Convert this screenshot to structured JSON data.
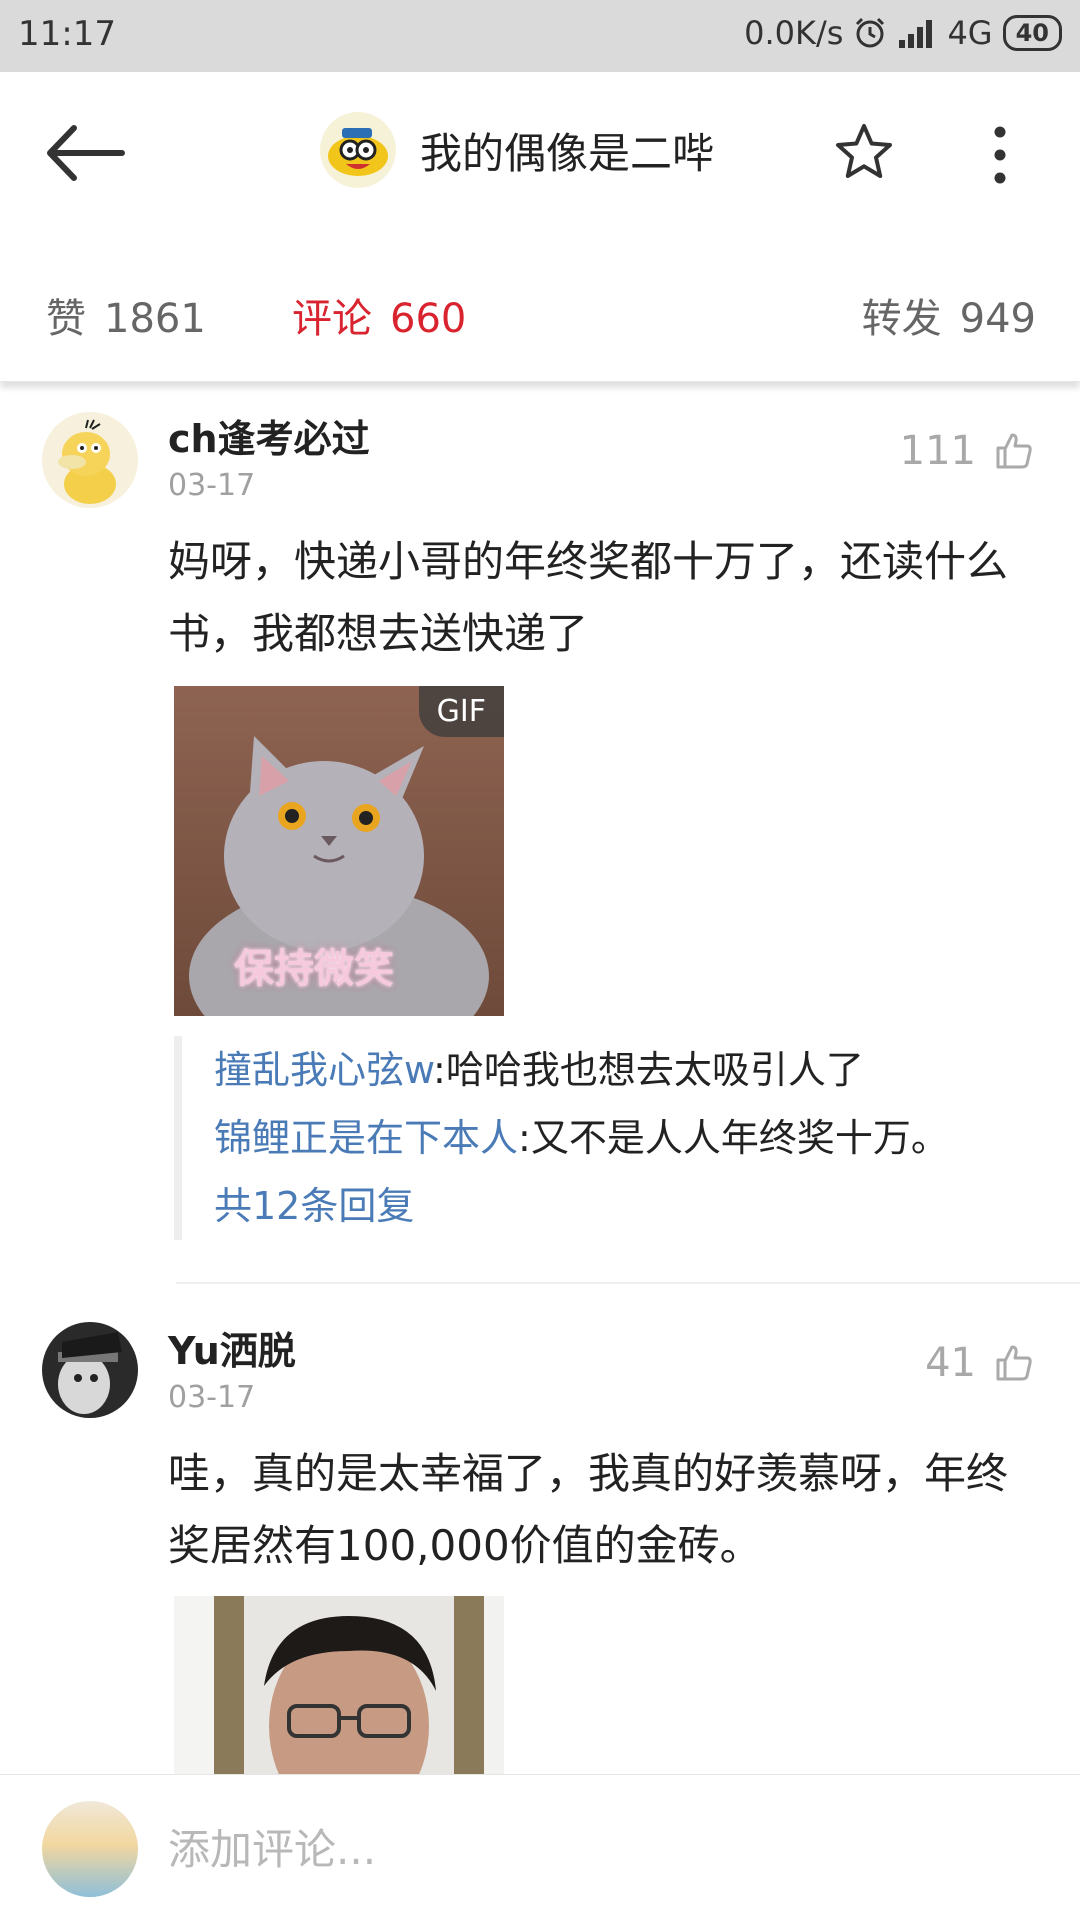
{
  "status_bar": {
    "time": "11:17",
    "network_speed": "0.0K/s",
    "network_type": "4G",
    "battery": "40"
  },
  "header": {
    "title": "我的偶像是二哔",
    "back_icon": "back-arrow-icon",
    "star_icon": "star-outline-icon",
    "more_icon": "more-vertical-icon"
  },
  "stats": {
    "like_label": "赞",
    "like_count": "1861",
    "comment_label": "评论",
    "comment_count": "660",
    "repost_label": "转发",
    "repost_count": "949",
    "active_color": "#d9232e"
  },
  "comments": [
    {
      "username": "ch逢考必过",
      "date": "03-17",
      "likes": "111",
      "text": "妈呀，快递小哥的年终奖都十万了，还读什么书，我都想去送快递了",
      "image_badge": "GIF",
      "image_caption": "保持微笑",
      "replies": [
        {
          "name": "撞乱我心弦w",
          "text": ":哈哈我也想去太吸引人了"
        },
        {
          "name": "锦鲤正是在下本人",
          "text": ":又不是人人年终奖十万。"
        }
      ],
      "more_replies": "共12条回复"
    },
    {
      "username": "Yu洒脱",
      "date": "03-17",
      "likes": "41",
      "text": "哇，真的是太幸福了，我真的好羡慕呀，年终奖居然有100,000价值的金砖。"
    }
  ],
  "bottom_bar": {
    "placeholder": "添加评论..."
  },
  "colors": {
    "link_blue": "#4a7bb7",
    "accent_red": "#d9232e"
  }
}
